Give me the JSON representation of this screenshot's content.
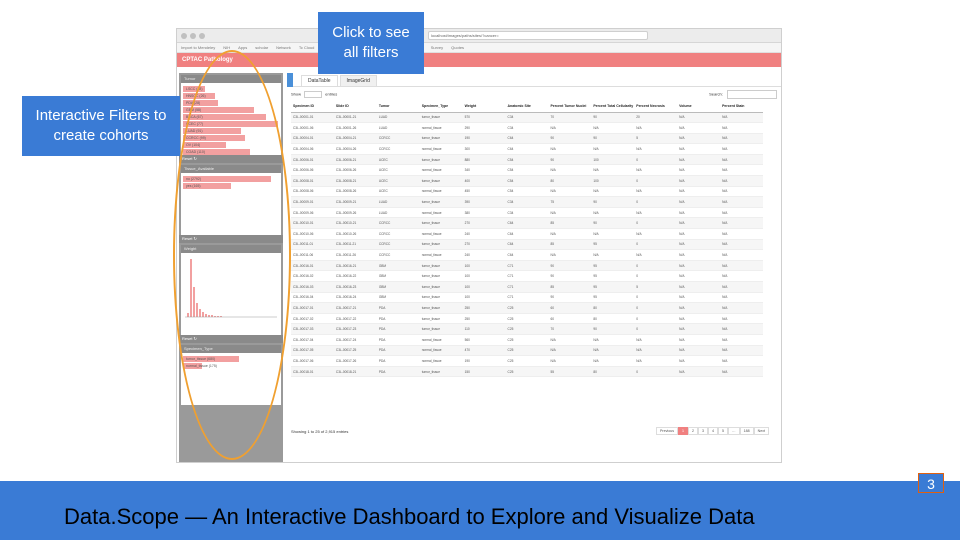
{
  "callouts": {
    "filters": "Click to see all filters",
    "cohorts": "Interactive Filters to create cohorts"
  },
  "slide": {
    "title": "Data.Scope — An Interactive Dashboard to Explore and Visualize Data",
    "number": "3"
  },
  "browser": {
    "url": "localhost/images/paths/sites/?cancer=",
    "bookmarks": [
      "Import to Mendeley",
      "NIH",
      "Apps",
      "scholar",
      "Network",
      "Tc Cloud",
      "Mendeley",
      "Bookmarks",
      "Boston",
      "Apply",
      "Data",
      "Survey",
      "Quotes"
    ]
  },
  "app": {
    "title": "CPTAC Pathology"
  },
  "filter_panel": {
    "widgets": [
      {
        "title": "Tumor",
        "bars": [
          {
            "label": "LSCC (18)",
            "value": 0.23
          },
          {
            "label": "HNSCC (26)",
            "value": 0.33
          },
          {
            "label": "PDA (28)",
            "value": 0.36
          },
          {
            "label": "GBM (58)",
            "value": 0.74
          },
          {
            "label": "BRCA (67)",
            "value": 0.86
          },
          {
            "label": "UCEC (77)",
            "value": 0.99
          },
          {
            "label": "LUAD (91)",
            "value": 0.6
          },
          {
            "label": "CCRCC (99)",
            "value": 0.65
          },
          {
            "label": "OV (104)",
            "value": 0.45
          },
          {
            "label": "COAD (110)",
            "value": 0.7
          }
        ],
        "reset": "Reset ↻"
      },
      {
        "title": "Tissue_Available",
        "bars": [
          {
            "label": "no (2792)",
            "value": 0.92
          },
          {
            "label": "yes (165)",
            "value": 0.5
          }
        ],
        "reset": "Reset ↻"
      },
      {
        "title": "Weight",
        "reset": "Reset ↻"
      },
      {
        "title": "Specimen_Type",
        "bars": [
          {
            "label": "tumor_tissue (680)",
            "value": 0.58
          },
          {
            "label": "normal_tissue (175)",
            "value": 0.2
          }
        ]
      }
    ]
  },
  "main": {
    "tabs": [
      "DataTable",
      "ImageGrid"
    ],
    "show_label": "Show",
    "entries_label": "entries",
    "search_label": "Search:",
    "columns": [
      "Specimen ID",
      "Slide ID",
      "Tumor",
      "Specimen_Type",
      "Weight",
      "Anatomic Site",
      "Percent Tumor Nuclei",
      "Percent Total Cellularity",
      "Percent Necrosis",
      "Volume",
      "Percent Stain"
    ],
    "rows": [
      [
        "C3L-00001-01",
        "C3L-00001-21",
        "LUAD",
        "tumor_tissue",
        "570",
        "C34",
        "70",
        "90",
        "20",
        "N/A",
        "N/A"
      ],
      [
        "C3L-00001-06",
        "C3L-00001-26",
        "LUAD",
        "normal_tissue",
        "290",
        "C34",
        "N/A",
        "N/A",
        "N/A",
        "N/A",
        "N/A"
      ],
      [
        "C3L-00004-01",
        "C3L-00004-21",
        "CCRCC",
        "tumor_tissue",
        "190",
        "C64",
        "90",
        "90",
        "5",
        "N/A",
        "N/A"
      ],
      [
        "C3L-00004-06",
        "C3L-00004-26",
        "CCRCC",
        "normal_tissue",
        "300",
        "C64",
        "N/A",
        "N/A",
        "N/A",
        "N/A",
        "N/A"
      ],
      [
        "C3L-00006-01",
        "C3L-00006-21",
        "UCEC",
        "tumor_tissue",
        "880",
        "C54",
        "90",
        "100",
        "0",
        "N/A",
        "N/A"
      ],
      [
        "C3L-00006-06",
        "C3L-00006-26",
        "UCEC",
        "normal_tissue",
        "340",
        "C54",
        "N/A",
        "N/A",
        "N/A",
        "N/A",
        "N/A"
      ],
      [
        "C3L-00008-01",
        "C3L-00008-21",
        "UCEC",
        "tumor_tissue",
        "400",
        "C54",
        "80",
        "100",
        "0",
        "N/A",
        "N/A"
      ],
      [
        "C3L-00008-06",
        "C3L-00008-26",
        "UCEC",
        "normal_tissue",
        "450",
        "C54",
        "N/A",
        "N/A",
        "N/A",
        "N/A",
        "N/A"
      ],
      [
        "C3L-00009-01",
        "C3L-00009-21",
        "LUAD",
        "tumor_tissue",
        "390",
        "C34",
        "75",
        "90",
        "0",
        "N/A",
        "N/A"
      ],
      [
        "C3L-00009-06",
        "C3L-00009-26",
        "LUAD",
        "normal_tissue",
        "380",
        "C34",
        "N/A",
        "N/A",
        "N/A",
        "N/A",
        "N/A"
      ],
      [
        "C3L-00010-01",
        "C3L-00010-21",
        "CCRCC",
        "tumor_tissue",
        "270",
        "C64",
        "85",
        "90",
        "0",
        "N/A",
        "N/A"
      ],
      [
        "C3L-00010-06",
        "C3L-00010-26",
        "CCRCC",
        "normal_tissue",
        "240",
        "C64",
        "N/A",
        "N/A",
        "N/A",
        "N/A",
        "N/A"
      ],
      [
        "C3L-00011-01",
        "C3L-00011-21",
        "CCRCC",
        "tumor_tissue",
        "270",
        "C64",
        "85",
        "95",
        "0",
        "N/A",
        "N/A"
      ],
      [
        "C3L-00011-06",
        "C3L-00011-26",
        "CCRCC",
        "normal_tissue",
        "240",
        "C64",
        "N/A",
        "N/A",
        "N/A",
        "N/A",
        "N/A"
      ],
      [
        "C3L-00016-01",
        "C3L-00016-21",
        "GBM",
        "tumor_tissue",
        "100",
        "C71",
        "90",
        "95",
        "0",
        "N/A",
        "N/A"
      ],
      [
        "C3L-00016-02",
        "C3L-00016-22",
        "GBM",
        "tumor_tissue",
        "100",
        "C71",
        "90",
        "95",
        "0",
        "N/A",
        "N/A"
      ],
      [
        "C3L-00016-03",
        "C3L-00016-23",
        "GBM",
        "tumor_tissue",
        "100",
        "C71",
        "85",
        "95",
        "5",
        "N/A",
        "N/A"
      ],
      [
        "C3L-00016-04",
        "C3L-00016-24",
        "GBM",
        "tumor_tissue",
        "100",
        "C71",
        "90",
        "95",
        "0",
        "N/A",
        "N/A"
      ],
      [
        "C3L-00017-01",
        "C3L-00017-21",
        "PDA",
        "tumor_tissue",
        "250",
        "C25",
        "60",
        "80",
        "0",
        "N/A",
        "N/A"
      ],
      [
        "C3L-00017-02",
        "C3L-00017-22",
        "PDA",
        "tumor_tissue",
        "250",
        "C25",
        "60",
        "80",
        "0",
        "N/A",
        "N/A"
      ],
      [
        "C3L-00017-03",
        "C3L-00017-23",
        "PDA",
        "tumor_tissue",
        "110",
        "C25",
        "70",
        "90",
        "0",
        "N/A",
        "N/A"
      ],
      [
        "C3L-00017-04",
        "C3L-00017-24",
        "PDA",
        "normal_tissue",
        "560",
        "C25",
        "N/A",
        "N/A",
        "N/A",
        "N/A",
        "N/A"
      ],
      [
        "C3L-00017-05",
        "C3L-00017-25",
        "PDA",
        "normal_tissue",
        "470",
        "C25",
        "N/A",
        "N/A",
        "N/A",
        "N/A",
        "N/A"
      ],
      [
        "C3L-00017-06",
        "C3L-00017-26",
        "PDA",
        "normal_tissue",
        "190",
        "C25",
        "N/A",
        "N/A",
        "N/A",
        "N/A",
        "N/A"
      ],
      [
        "C3L-00018-01",
        "C3L-00018-21",
        "PDA",
        "tumor_tissue",
        "150",
        "C25",
        "55",
        "80",
        "0",
        "N/A",
        "N/A"
      ]
    ],
    "showing_text": "Showing 1 to 25 of 2,915 entries",
    "pagination": [
      "Previous",
      "1",
      "2",
      "3",
      "4",
      "5",
      "…",
      "188",
      "Next"
    ]
  }
}
